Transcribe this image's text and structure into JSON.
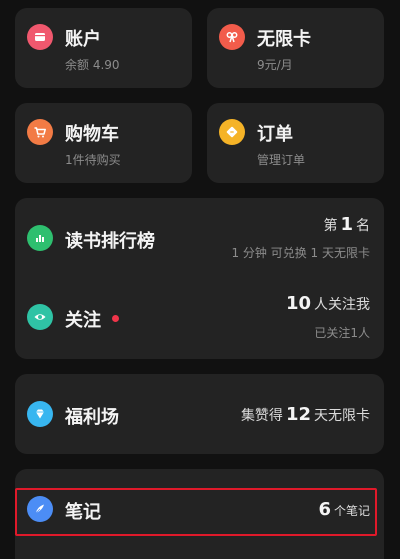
{
  "account": {
    "title": "账户",
    "sub": "余额 4.90"
  },
  "vip": {
    "title": "无限卡",
    "sub": "9元/月"
  },
  "cart": {
    "title": "购物车",
    "sub": "1件待购买"
  },
  "orders": {
    "title": "订单",
    "sub": "管理订单"
  },
  "ranking": {
    "title": "读书排行榜",
    "rank_prefix": "第",
    "rank_value": "1",
    "rank_suffix": "名",
    "detail": "1 分钟 可兑换 1 天无限卡"
  },
  "follow": {
    "title": "关注",
    "followers_value": "10",
    "followers_suffix": "人关注我",
    "following_text": "已关注1人"
  },
  "welfare": {
    "title": "福利场",
    "prefix": "集赞得",
    "value": "12",
    "suffix": "天无限卡"
  },
  "notes": {
    "title": "笔记",
    "value": "6",
    "suffix": "个笔记"
  },
  "colors": {
    "account_icon": "#f0586e",
    "vip_icon": "#f25c4b",
    "cart_icon": "#f27b45",
    "orders_icon": "#f5b327",
    "ranking_icon": "#2ebf6f",
    "follow_icon": "#2fc3a5",
    "welfare_icon": "#38b6f0",
    "notes_icon": "#4c8df5",
    "highlight": "#e0192a"
  },
  "icons": {
    "account": "wallet-icon",
    "vip": "ribbon-icon",
    "cart": "cart-icon",
    "orders": "ticket-icon",
    "ranking": "bar-chart-icon",
    "follow": "eye-icon",
    "welfare": "diamond-icon",
    "notes": "feather-icon"
  }
}
